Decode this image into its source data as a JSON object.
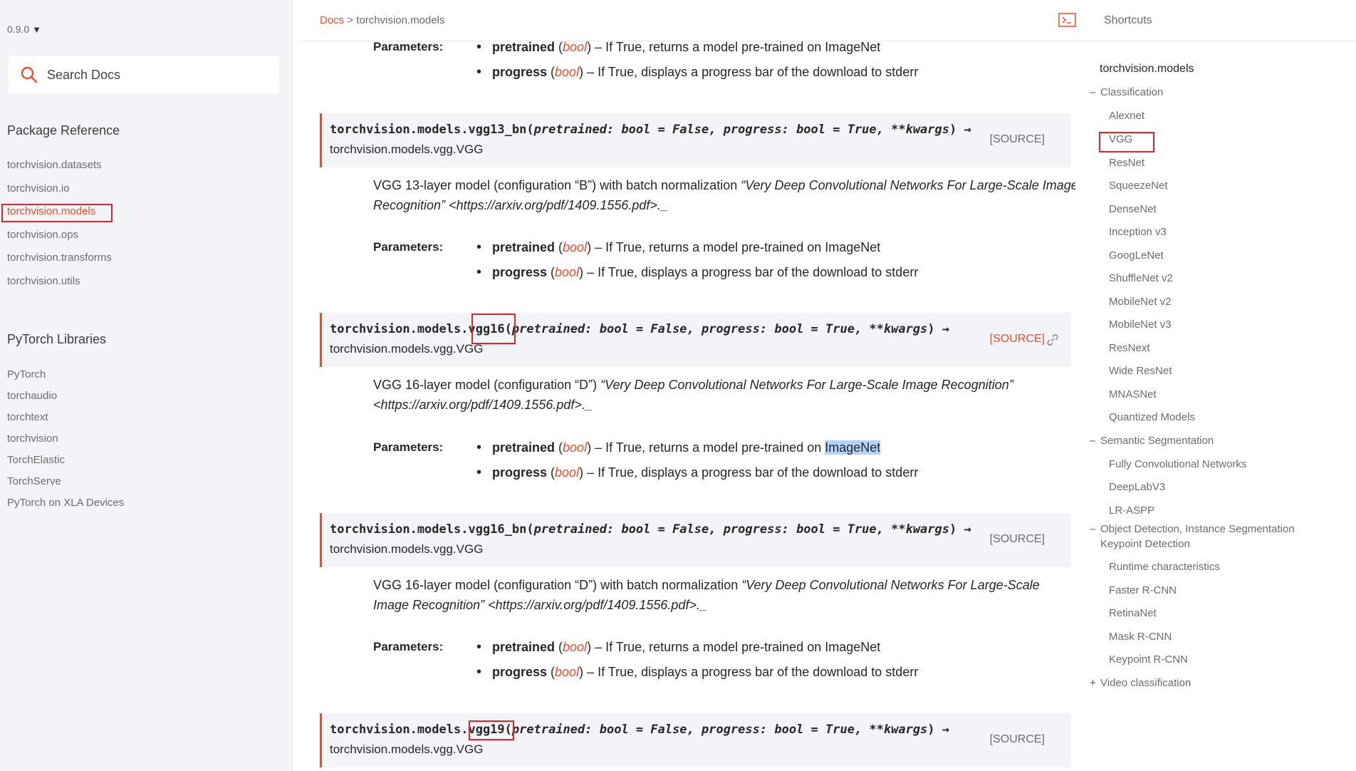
{
  "sidebar": {
    "version": "0.9.0",
    "search_placeholder": "Search Docs",
    "package_reference_title": "Package Reference",
    "package_items": [
      "torchvision.datasets",
      "torchvision.io",
      "torchvision.models",
      "torchvision.ops",
      "torchvision.transforms",
      "torchvision.utils"
    ],
    "libraries_title": "PyTorch Libraries",
    "library_items": [
      "PyTorch",
      "torchaudio",
      "torchtext",
      "torchvision",
      "TorchElastic",
      "TorchServe",
      "PyTorch on XLA Devices"
    ]
  },
  "breadcrumb": {
    "docs": "Docs",
    "sep": ">",
    "current": "torchvision.models"
  },
  "shortcuts_label": "Shortcuts",
  "params_label": "Parameters:",
  "param_pretrained": {
    "name": "pretrained",
    "type": "bool",
    "lparen": " (",
    "rparen": ")",
    "desc": " – If True, returns a model pre-trained on ",
    "desc_end": "ImageNet"
  },
  "param_progress": {
    "name": "progress",
    "type": "bool",
    "lparen": " (",
    "rparen": ")",
    "desc": " – If True, displays a progress bar of the download to stderr"
  },
  "signatures": [
    {
      "prefix": "torchvision.models.",
      "fn": "vgg13_bn",
      "open": "(",
      "args": "pretrained: bool = False, progress: bool = True, **kwargs",
      "close": ")",
      "arrow": " →",
      "ret": "torchvision.models.vgg.VGG",
      "source": "[SOURCE]"
    },
    {
      "prefix": "torchvision.models.",
      "fn": "vgg16",
      "open": "(",
      "args": "pretrained: bool = False, progress: bool = True, **kwargs",
      "close": ")",
      "arrow": " →",
      "ret": "torchvision.models.vgg.VGG",
      "source": "[SOURCE]"
    },
    {
      "prefix": "torchvision.models.",
      "fn": "vgg16_bn",
      "open": "(",
      "args": "pretrained: bool = False, progress: bool = True, **kwargs",
      "close": ")",
      "arrow": " →",
      "ret": "torchvision.models.vgg.VGG",
      "source": "[SOURCE]"
    },
    {
      "prefix": "torchvision.models.",
      "fn": "vgg19",
      "open": "(",
      "args": "pretrained: bool = False, progress: bool = True, **kwargs",
      "close": ")",
      "arrow": " →",
      "ret": "torchvision.models.vgg.VGG",
      "source": "[SOURCE]"
    }
  ],
  "descriptions": [
    {
      "lead": "VGG 13-layer model (configuration “B”) with batch normalization ",
      "title": "“Very Deep Convolutional Networks For Large-Scale Image Recognition” <https://arxiv.org/pdf/1409.1556.pdf>._"
    },
    {
      "lead": "VGG 16-layer model (configuration “D”) ",
      "title": "“Very Deep Convolutional Networks For Large-Scale Image Recognition” <https://arxiv.org/pdf/1409.1556.pdf>._"
    },
    {
      "lead": "VGG 16-layer model (configuration “D”) with batch normalization ",
      "title": "“Very Deep Convolutional Networks For Large-Scale Image Recognition” <https://arxiv.org/pdf/1409.1556.pdf>._"
    }
  ],
  "toc": {
    "title": "torchvision.models",
    "classification": {
      "mark": "–",
      "label": "Classification"
    },
    "classification_items": [
      "Alexnet",
      "VGG",
      "ResNet",
      "SqueezeNet",
      "DenseNet",
      "Inception v3",
      "GoogLeNet",
      "ShuffleNet v2",
      "MobileNet v2",
      "MobileNet v3",
      "ResNext",
      "Wide ResNet",
      "MNASNet",
      "Quantized Models"
    ],
    "semantic": {
      "mark": "–",
      "label": "Semantic Segmentation"
    },
    "semantic_items": [
      "Fully Convolutional Networks",
      "DeepLabV3",
      "LR-ASPP"
    ],
    "detection": {
      "mark": "–",
      "label": "Object Detection, Instance Segmentation",
      "label2": "Keypoint Detection"
    },
    "detection_items": [
      "Runtime characteristics",
      "Faster R-CNN",
      "RetinaNet",
      "Mask R-CNN",
      "Keypoint R-CNN"
    ],
    "video": {
      "mark": "+",
      "label": "Video classification"
    }
  },
  "colors": {
    "accent": "#ee4c2c",
    "highlight_box": "#d8272f",
    "sidebar_bg": "#f3f4f7",
    "selection": "#b3d4fc"
  }
}
